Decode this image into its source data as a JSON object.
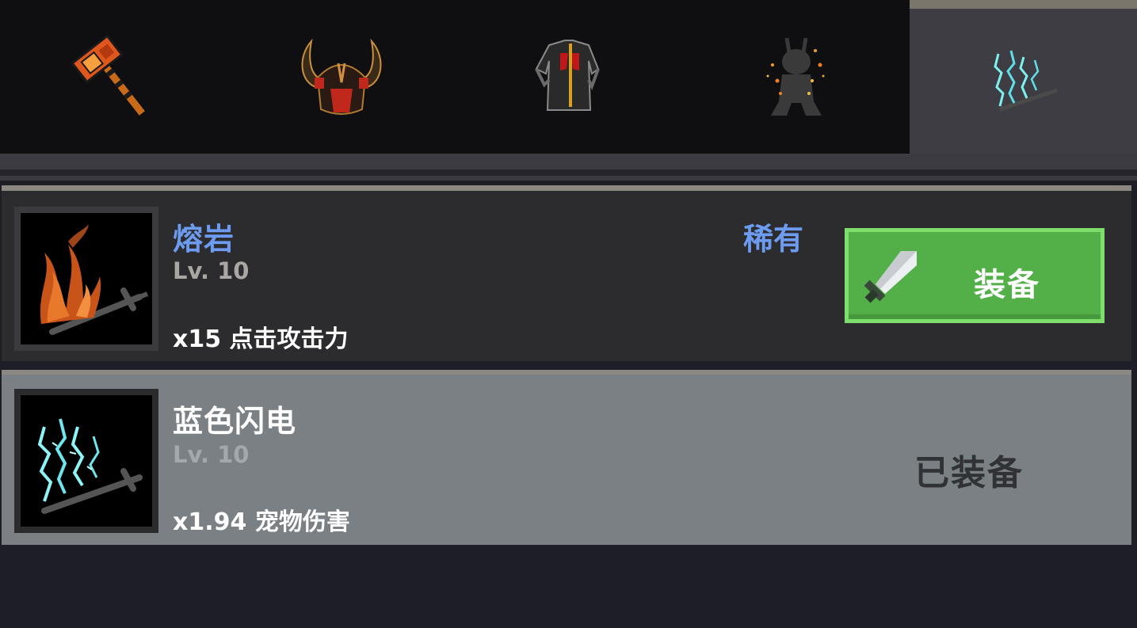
{
  "tabs": [
    {
      "icon": "hammer-icon",
      "active": false
    },
    {
      "icon": "horned-helmet-icon",
      "active": false
    },
    {
      "icon": "armor-icon",
      "active": false
    },
    {
      "icon": "fire-pet-icon",
      "active": false
    },
    {
      "icon": "blue-lightning-icon",
      "active": true
    }
  ],
  "items": [
    {
      "name": "熔岩",
      "level": "Lv. 10",
      "stat": "x15 点击攻击力",
      "rarity": "稀有",
      "icon": "lava-sword-icon",
      "action": {
        "label": "装备",
        "icon": "sword-icon"
      }
    },
    {
      "name": "蓝色闪电",
      "level": "Lv. 10",
      "stat": "x1.94 宠物伤害",
      "icon": "lightning-sword-icon",
      "status": "已装备"
    }
  ],
  "colors": {
    "rarity_blue": "#6c9bf0",
    "equip_green": "#53b049",
    "equipped_row": "#7a8084"
  }
}
